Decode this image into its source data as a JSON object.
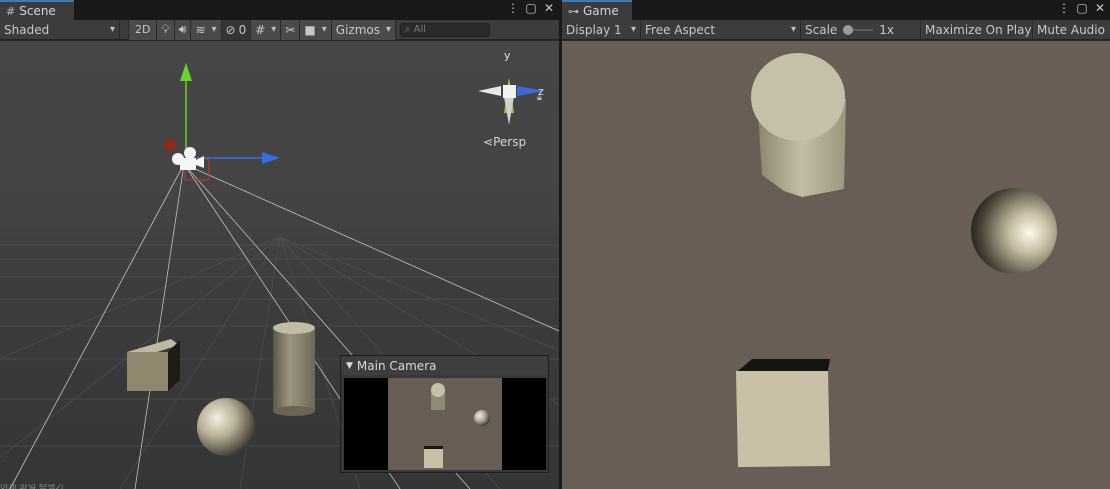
{
  "scene": {
    "tab": {
      "label": "Scene",
      "icon": "grid-icon"
    },
    "toolbar": {
      "draw_mode": "Shaded",
      "mode_2d": "2D",
      "hidden_count": "0",
      "gizmos": "Gizmos",
      "search_placeholder": "All"
    },
    "orientation_gizmo": {
      "y_label": "y",
      "z_label": "z",
      "projection": "Persp"
    },
    "camera_preview": {
      "title": "Main Camera"
    },
    "status_text": "이제 파일 탐색기"
  },
  "game": {
    "tab": {
      "label": "Game",
      "icon": "gamepad-icon"
    },
    "toolbar": {
      "display": "Display 1",
      "aspect": "Free Aspect",
      "scale_label": "Scale",
      "scale_value": "1x",
      "maximize_on_play": "Maximize On Play",
      "mute_audio": "Mute Audio"
    }
  },
  "colors": {
    "game_background": "#685e55",
    "object_color": "#c8c0a6",
    "axis_x": "#2f6ee6",
    "axis_y": "#6ad32c",
    "tab_accent": "#3a79bb"
  }
}
